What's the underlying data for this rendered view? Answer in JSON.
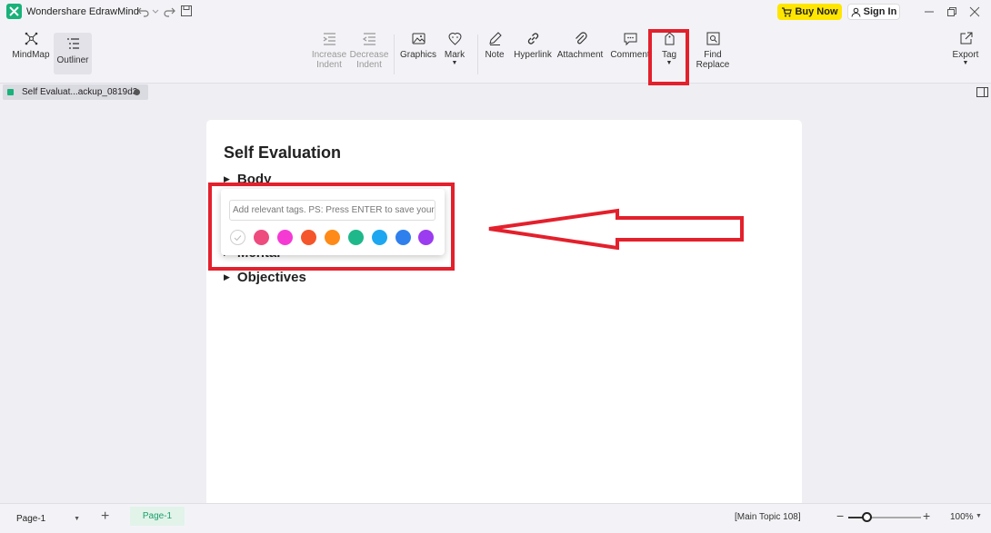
{
  "titlebar": {
    "app_title": "Wondershare EdrawMind",
    "buy_label": "Buy Now",
    "signin_label": "Sign In"
  },
  "ribbon": {
    "view_buttons": [
      {
        "label": "MindMap",
        "icon": "mindmap-icon"
      },
      {
        "label": "Outliner",
        "icon": "outliner-icon",
        "active": true
      }
    ],
    "increase_indent": [
      "Increase",
      "Indent"
    ],
    "decrease_indent": [
      "Decrease",
      "Indent"
    ],
    "graphics": "Graphics",
    "mark": "Mark",
    "note": "Note",
    "hyperlink": "Hyperlink",
    "attachment": "Attachment",
    "comment": "Comment",
    "tag": "Tag",
    "find_replace": [
      "Find",
      "Replace"
    ],
    "export": "Export"
  },
  "doc_tab": {
    "label": "Self Evaluat...ackup_0819d3"
  },
  "outline": {
    "title": "Self Evaluation",
    "topics": [
      "Body",
      "Mental",
      "Objectives"
    ]
  },
  "tag_popup": {
    "placeholder": "Add relevant tags. PS: Press ENTER to save your tag.",
    "colors": [
      "#ee4b7f",
      "#f53ad4",
      "#f5552a",
      "#ff8a17",
      "#1fb88a",
      "#1ea7f0",
      "#2f80ed",
      "#9b3cf0"
    ]
  },
  "statusbar": {
    "page_select": "Page-1",
    "page_tab": "Page-1",
    "status": "[Main Topic 108]",
    "zoom": "100%",
    "zoom_level": 0.25
  },
  "colors": {
    "accent": "#19b27a",
    "annotation": "#e3202c",
    "buy_now": "#ffe600"
  }
}
